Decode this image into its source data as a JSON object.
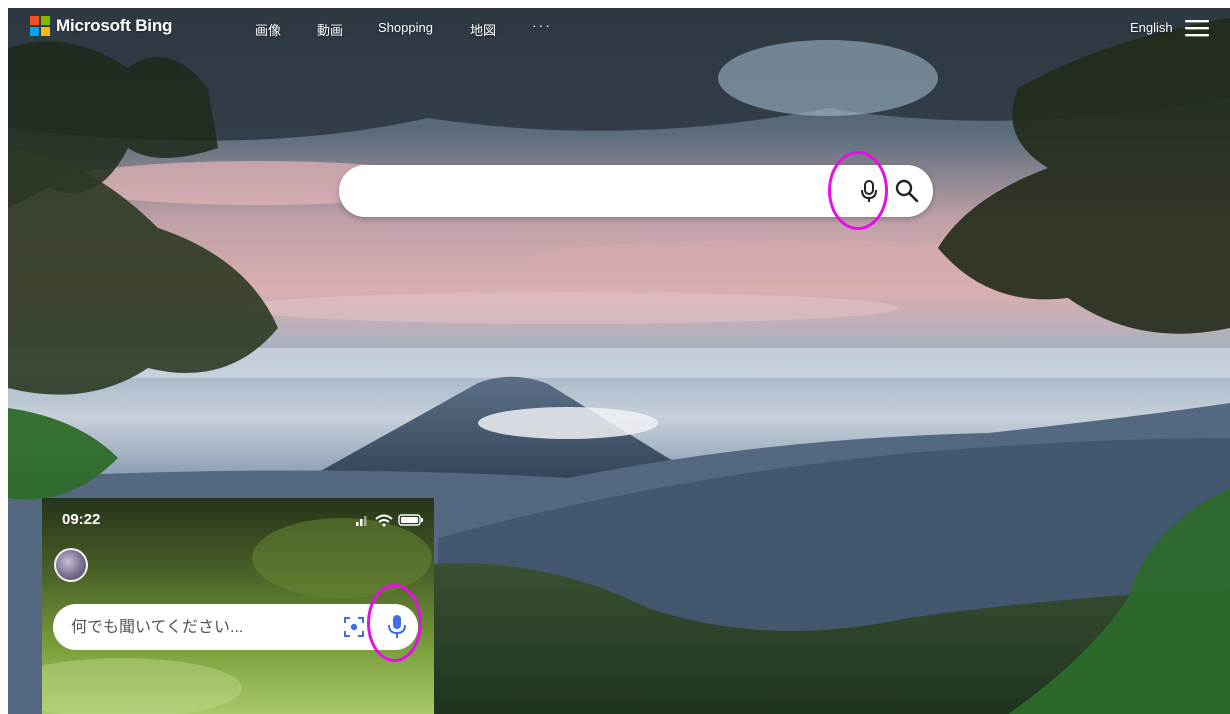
{
  "header": {
    "logo_text": "Microsoft Bing",
    "nav": [
      "画像",
      "動画",
      "Shopping",
      "地図"
    ],
    "more": "···",
    "language": "English",
    "menu_icon": "hamburger-menu-icon"
  },
  "search": {
    "value": "",
    "placeholder": "",
    "mic_icon": "microphone-icon",
    "search_icon": "magnifier-icon"
  },
  "phone": {
    "time": "09:22",
    "search_placeholder": "何でも聞いてください...",
    "scan_icon": "visual-search-icon",
    "mic_icon": "microphone-icon"
  },
  "colors": {
    "highlight": "#e610e6",
    "ms_red": "#f25022",
    "ms_green": "#7fba00",
    "ms_blue": "#00a4ef",
    "ms_yellow": "#ffb900",
    "phone_mic_blue": "#3d6ee8"
  }
}
